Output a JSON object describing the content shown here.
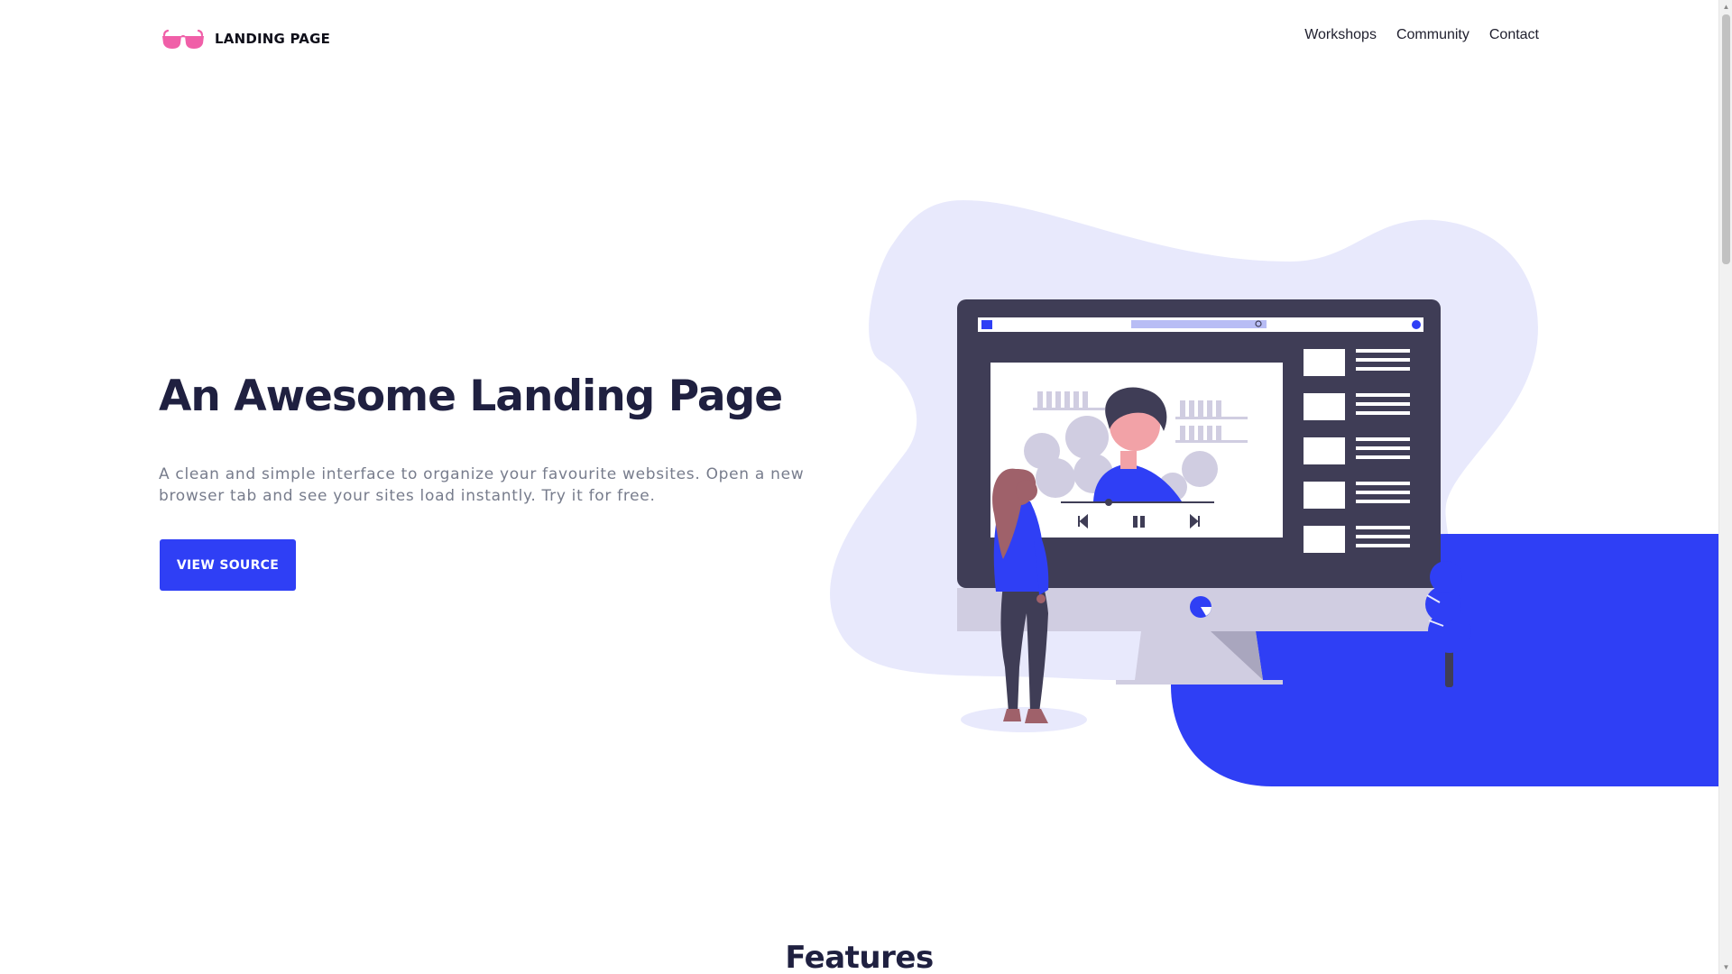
{
  "header": {
    "logo_text": "LANDING PAGE",
    "logo_icon": "sunglasses-icon",
    "nav": [
      {
        "label": "Workshops"
      },
      {
        "label": "Community"
      },
      {
        "label": "Contact"
      }
    ]
  },
  "hero": {
    "title": "An Awesome Landing Page",
    "description": "A clean and simple interface to organize your favourite websites. Open a new browser tab and see your sites load instantly. Try it for free.",
    "button_label": "VIEW SOURCE"
  },
  "features": {
    "title": "Features"
  },
  "colors": {
    "accent": "#2f3ff5",
    "logo_pink": "#f05fa8",
    "blob": "#e8e9fc",
    "monitor": "#3f3d56",
    "heading": "#1f2040",
    "body_text": "#777c8c"
  },
  "illustration": {
    "name": "person-watching-video-on-monitor-illustration"
  }
}
